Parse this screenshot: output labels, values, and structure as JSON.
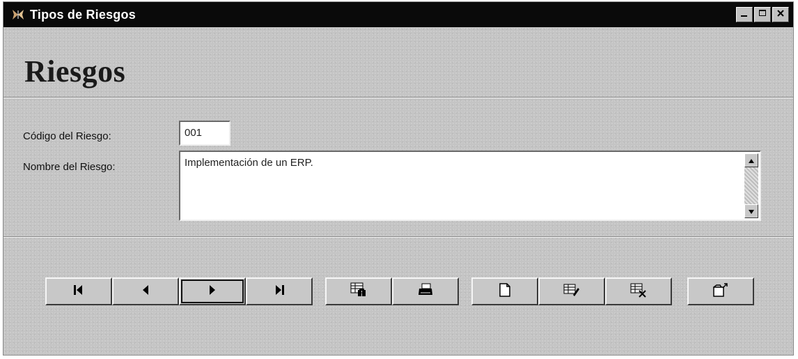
{
  "window": {
    "title": "Tipos de Riesgos",
    "app_icon": "butterfly-icon",
    "controls": [
      "minimize-icon",
      "maximize-icon",
      "close-icon"
    ]
  },
  "form": {
    "heading": "Riesgos",
    "codigo_label": "Código del Riesgo:",
    "codigo_value": "001",
    "nombre_label": "Nombre del Riesgo:",
    "nombre_value": "Implementación de un ERP."
  },
  "toolbar": {
    "buttons": [
      {
        "name": "first-record",
        "icon": "first-icon"
      },
      {
        "name": "previous-record",
        "icon": "previous-icon"
      },
      {
        "name": "next-record",
        "icon": "next-icon"
      },
      {
        "name": "last-record",
        "icon": "last-icon"
      },
      {
        "name": "find-record",
        "icon": "find-record-icon"
      },
      {
        "name": "print",
        "icon": "printer-icon"
      },
      {
        "name": "new-record",
        "icon": "new-document-icon"
      },
      {
        "name": "edit-record",
        "icon": "edit-record-icon"
      },
      {
        "name": "delete-record",
        "icon": "delete-record-icon"
      },
      {
        "name": "close-form",
        "icon": "exit-icon"
      }
    ]
  }
}
